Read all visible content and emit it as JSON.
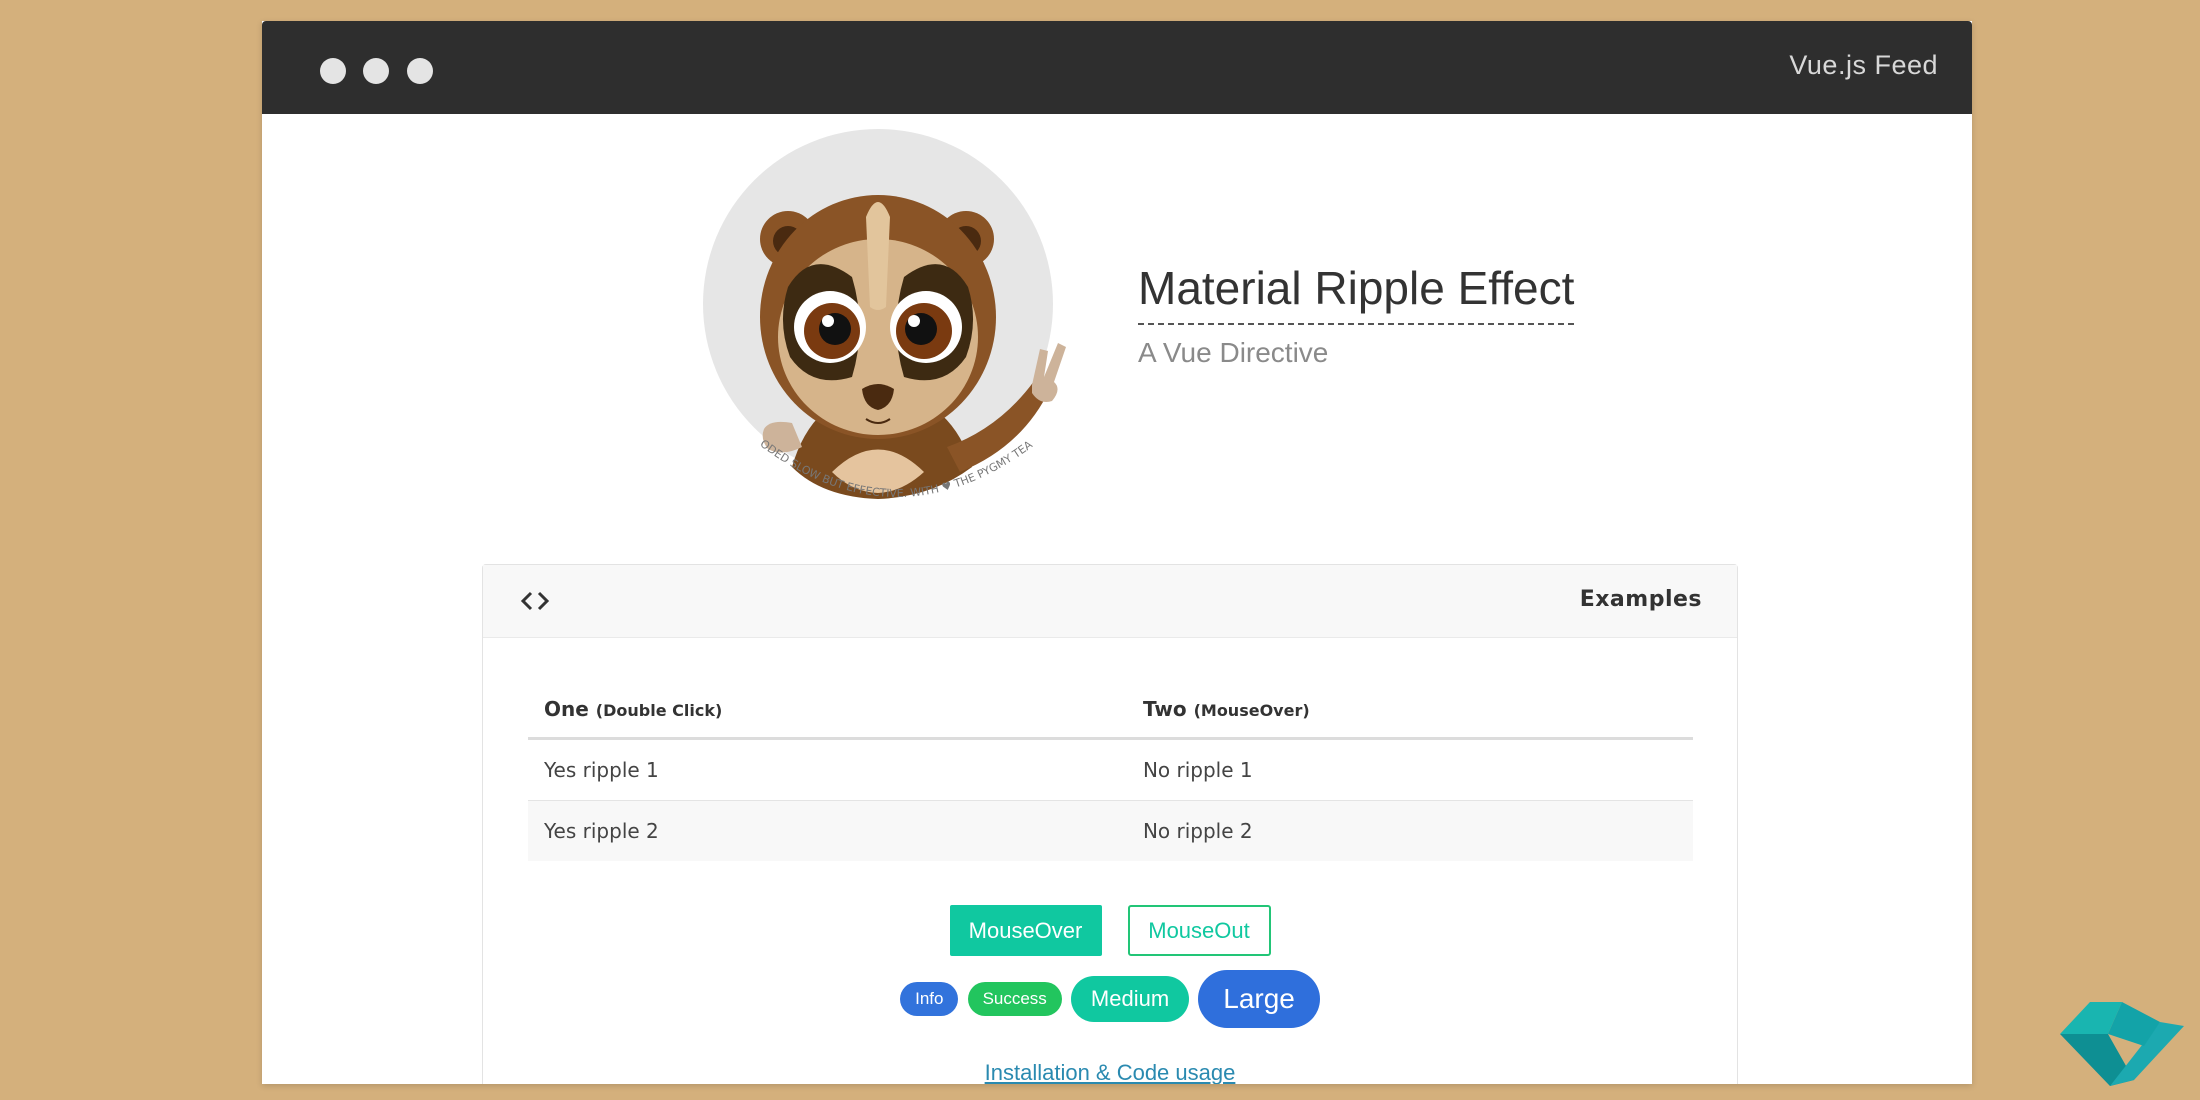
{
  "window": {
    "title": "Vue.js Feed"
  },
  "header": {
    "logo_icon": "slow-loris-mascot-icon",
    "logo_text": "CODED SLOW BUT EFFECTIVE. WITH ♥ THE PYGMY TEAM",
    "title": "Material Ripple Effect",
    "subtitle": "A Vue Directive"
  },
  "card": {
    "icon": "code-icon",
    "header_label": "Examples",
    "table": {
      "columns": [
        {
          "label": "One",
          "hint": "(Double Click)"
        },
        {
          "label": "Two",
          "hint": "(MouseOver)"
        }
      ],
      "rows": [
        [
          "Yes ripple 1",
          "No ripple 1"
        ],
        [
          "Yes ripple 2",
          "No ripple 2"
        ]
      ]
    },
    "buttons": {
      "mouseover": "MouseOver",
      "mouseout": "MouseOut",
      "info": "Info",
      "success": "Success",
      "medium": "Medium",
      "large": "Large"
    },
    "link": "Installation & Code usage"
  },
  "colors": {
    "background": "#d4b07c",
    "titlebar": "#2e2e2e",
    "teal": "#10c8a0",
    "green": "#22c55e",
    "blue": "#3273dc",
    "link": "#2a8ab0"
  }
}
